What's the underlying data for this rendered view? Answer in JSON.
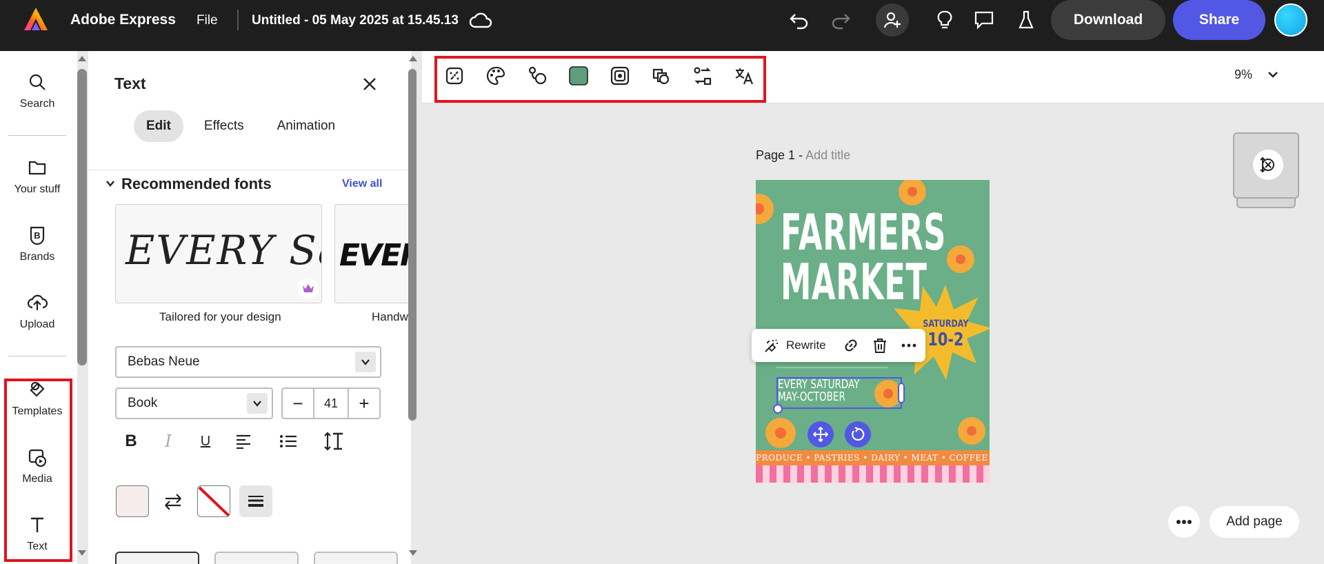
{
  "topbar": {
    "app_name": "Adobe Express",
    "file_menu": "File",
    "doc_title": "Untitled - 05 May 2025 at 15.45.13",
    "download_label": "Download",
    "share_label": "Share",
    "icons": [
      "adobe-express-logo",
      "cloud-icon",
      "undo-icon",
      "redo-icon",
      "invite-user-icon",
      "lightbulb-icon",
      "comment-icon",
      "flask-icon",
      "avatar"
    ]
  },
  "rail": {
    "items": [
      {
        "label": "Search",
        "icon": "search-icon"
      },
      {
        "label": "Your stuff",
        "icon": "folder-icon"
      },
      {
        "label": "Brands",
        "icon": "brand-icon"
      },
      {
        "label": "Upload",
        "icon": "upload-icon"
      },
      {
        "label": "Templates",
        "icon": "templates-icon"
      },
      {
        "label": "Media",
        "icon": "media-icon"
      },
      {
        "label": "Text",
        "icon": "text-icon"
      }
    ]
  },
  "panel": {
    "title": "Text",
    "tabs": [
      {
        "label": "Edit",
        "active": true
      },
      {
        "label": "Effects",
        "active": false
      },
      {
        "label": "Animation",
        "active": false
      }
    ],
    "recommended_heading": "Recommended fonts",
    "view_all": "View all",
    "font_cards": [
      {
        "sample": "EVERY Satu",
        "label": "Tailored for your design"
      },
      {
        "sample": "EVER",
        "label": "Handw"
      }
    ],
    "font_family": "Bebas Neue",
    "font_weight": "Book",
    "font_size": "41",
    "stepper_minus": "−",
    "stepper_plus": "+",
    "format_buttons": [
      "B",
      "I",
      "U"
    ],
    "colors": {
      "fill": "#f6ecec",
      "accent": "#5258e4",
      "highlight": "#e1141e"
    }
  },
  "toolbar": {
    "tools": [
      "animate-icon",
      "color-palette-icon",
      "shape-icon",
      "fill-color-swatch",
      "mask-icon",
      "layer-icon",
      "replace-icon",
      "translate-icon"
    ],
    "zoom": "9%"
  },
  "canvas": {
    "page_label": "Page 1 - ",
    "add_title": "Add title",
    "poster": {
      "title_line1": "FARMERS",
      "title_line2": "MARKET",
      "star_text_line1": "SATURDAY",
      "star_text_line2": "10-2",
      "sub_line1": "EVERY SATURDAY",
      "sub_line2": "MAY-OCTOBER",
      "strip": "PRODUCE • PASTRIES • DAIRY • MEAT • COFFEE • FOOD TRUCKS"
    },
    "context_bar": {
      "rewrite": "Rewrite"
    },
    "add_page": "Add page"
  }
}
